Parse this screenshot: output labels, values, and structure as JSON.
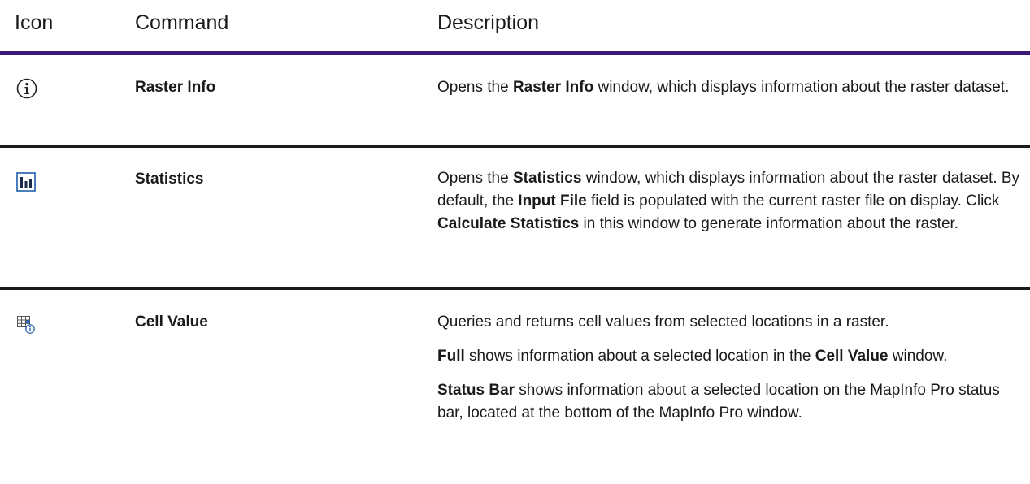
{
  "header": {
    "icon": "Icon",
    "command": "Command",
    "description": "Description"
  },
  "colors": {
    "header_rule": "#3d1a78",
    "row_rule": "#1a1a1a",
    "icon_blue": "#1f5fa8"
  },
  "rows": [
    {
      "icon": "info-circle-icon",
      "command": "Raster Info",
      "desc": {
        "pre": "Opens the ",
        "bold1": "Raster Info",
        "post": " window, which displays information about the raster dataset."
      }
    },
    {
      "icon": "bar-chart-icon",
      "command": "Statistics",
      "desc": {
        "pre": "Opens the ",
        "bold1": "Statistics",
        "mid1": " window, which displays information about the raster dataset. By default, the ",
        "bold2": "Input File",
        "mid2": " field is populated with the current raster file on display. Click ",
        "bold3": "Calculate Statistics",
        "post": " in this window to generate information about the raster."
      }
    },
    {
      "icon": "grid-cell-info-icon",
      "command": "Cell Value",
      "p1": "Queries and returns cell values from selected locations in a raster.",
      "p2": {
        "bold1": "Full",
        "mid": " shows information about a selected location in the ",
        "bold2": "Cell Value",
        "post": " window."
      },
      "p3": {
        "bold1": "Status Bar",
        "post": " shows information about a selected location on the MapInfo Pro status bar, located at the bottom of the MapInfo Pro window."
      }
    }
  ]
}
